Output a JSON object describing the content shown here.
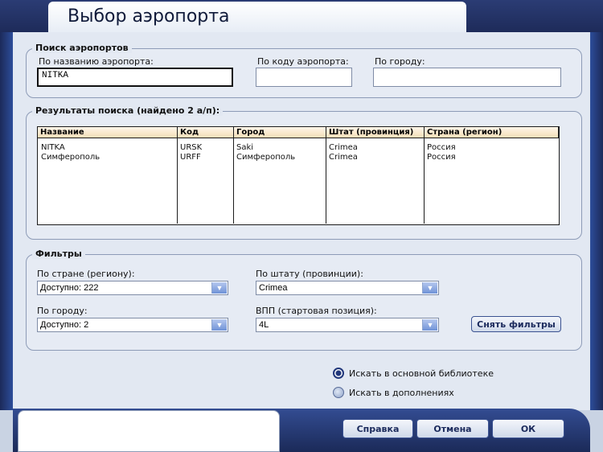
{
  "window": {
    "title": "Выбор аэропорта"
  },
  "search": {
    "legend": "Поиск аэропортов",
    "by_name_label": "По названию аэропорта:",
    "by_name_value": "NITKA",
    "by_code_label": "По коду аэропорта:",
    "by_code_value": "",
    "by_city_label": "По городу:",
    "by_city_value": ""
  },
  "results": {
    "legend": "Результаты поиска (найдено 2 а/п):",
    "columns": [
      "Название",
      "Код",
      "Город",
      "Штат (провинция)",
      "Страна (регион)"
    ],
    "rows": [
      [
        "NITKA",
        "URSK",
        "Saki",
        "Crimea",
        "Россия"
      ],
      [
        "Симферополь",
        "URFF",
        "Симферополь",
        "Crimea",
        "Россия"
      ]
    ]
  },
  "filters": {
    "legend": "Фильтры",
    "country_label": "По стране (региону):",
    "country_value": "Доступно: 222",
    "state_label": "По штату (провинции):",
    "state_value": "Crimea",
    "city_label": "По городу:",
    "city_value": "Доступно: 2",
    "runway_label": "ВПП (стартовая позиция):",
    "runway_value": "4L",
    "clear_button": "Снять фильтры"
  },
  "scope": {
    "main_library": "Искать в основной библиотеке",
    "addons": "Искать в дополнениях",
    "selected": "main_library"
  },
  "buttons": {
    "help": "Справка",
    "cancel": "Отмена",
    "ok": "ОК"
  },
  "icons": {
    "dropdown": "chevron-down-icon"
  },
  "colors": {
    "accent": "#2d4d9a",
    "header": "#f3ddb7",
    "panel": "#e2e8f2"
  }
}
